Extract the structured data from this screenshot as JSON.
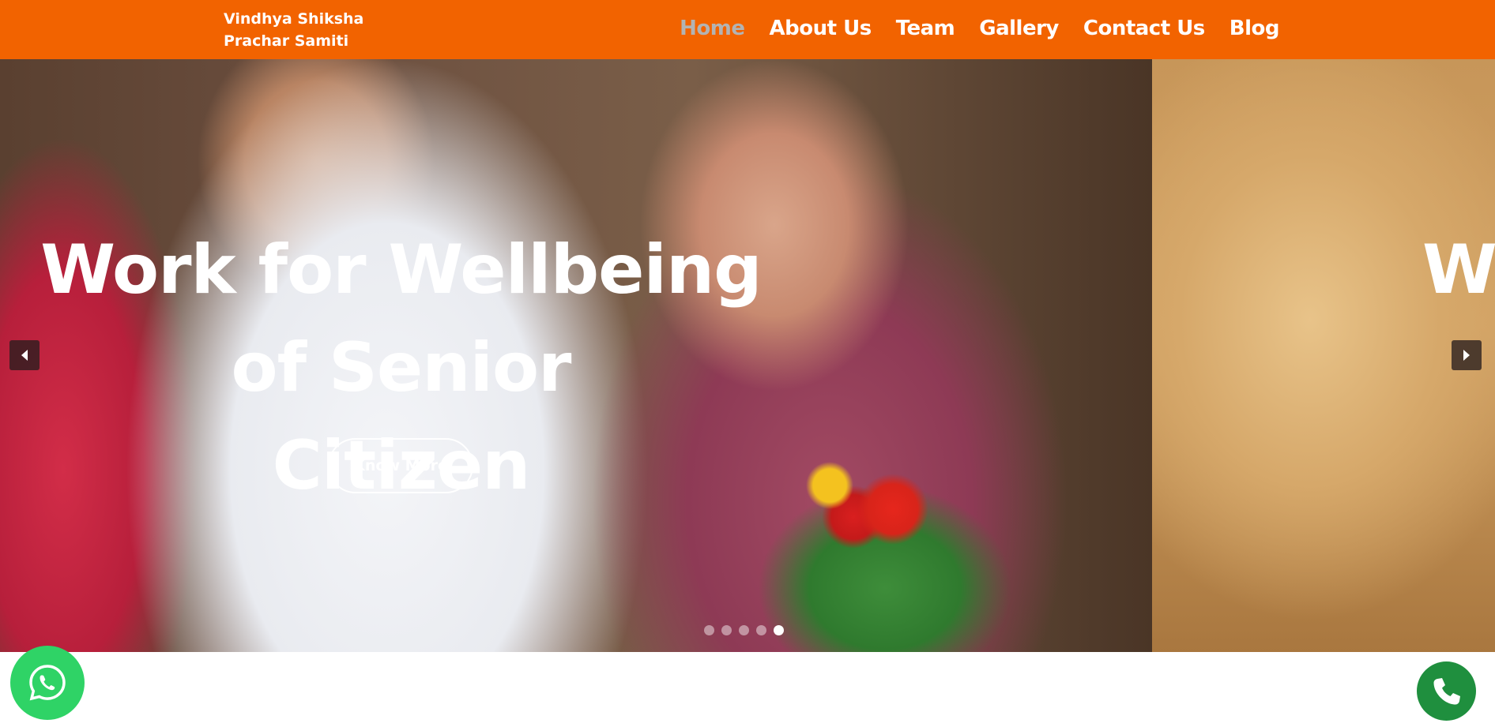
{
  "brand": {
    "line1": "Vindhya Shiksha",
    "line2": "Prachar Samiti"
  },
  "nav": {
    "items": [
      {
        "label": "Home",
        "active": true
      },
      {
        "label": "About Us",
        "active": false
      },
      {
        "label": "Team",
        "active": false
      },
      {
        "label": "Gallery",
        "active": false
      },
      {
        "label": "Contact Us",
        "active": false
      },
      {
        "label": "Blog",
        "active": false
      }
    ]
  },
  "hero": {
    "title_line1": "Work for Wellbeing of Senior",
    "title_line2": "Citizen",
    "next_title_peek": "W",
    "button_label": "Know More",
    "prev_icon": "chevron-left-icon",
    "next_icon": "chevron-right-icon",
    "dots_total": 5,
    "dots_active_index": 4
  },
  "floating": {
    "whatsapp_icon": "whatsapp-icon",
    "phone_icon": "phone-icon"
  },
  "colors": {
    "header_bg": "#f26300",
    "nav_active": "#b3b3b3",
    "whatsapp": "#2fd366",
    "phone": "#1f8f3e"
  }
}
